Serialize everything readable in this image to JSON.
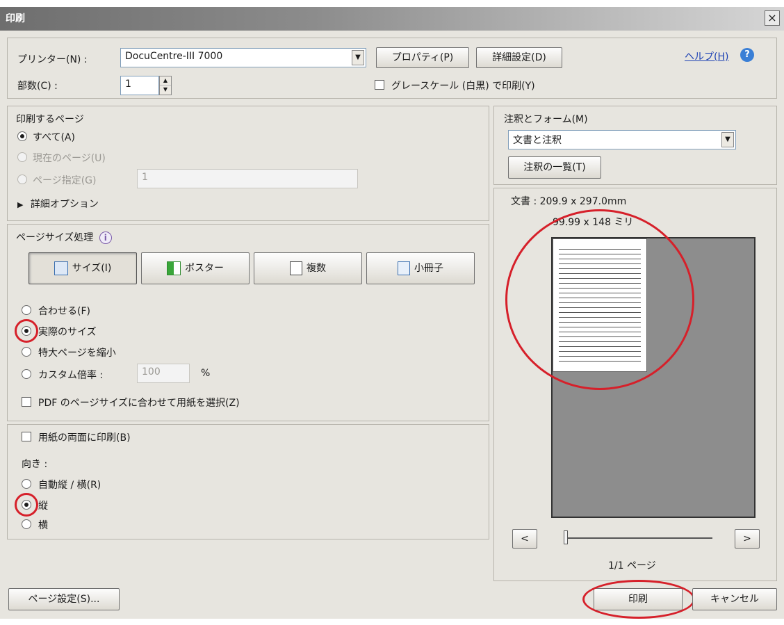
{
  "window": {
    "title": "印刷",
    "close": "×"
  },
  "printer": {
    "label": "プリンター(N) :",
    "selected": "DocuCentre-III 7000",
    "properties_button": "プロパティ(P)",
    "advanced_button": "詳細設定(D)",
    "help_link": "ヘルプ(H)",
    "copies_label": "部数(C) :",
    "copies_value": "1",
    "grayscale_label": "グレースケール (白黒) で印刷(Y)"
  },
  "pages": {
    "heading": "印刷するページ",
    "all": "すべて(A)",
    "current": "現在のページ(U)",
    "range": "ページ指定(G)",
    "range_value": "1",
    "more_options": "詳細オプション"
  },
  "page_size": {
    "heading": "ページサイズ処理",
    "tabs": [
      "サイズ(I)",
      "ポスター",
      "複数",
      "小冊子"
    ],
    "options": [
      "合わせる(F)",
      "実際のサイズ",
      "特大ページを縮小",
      "カスタム倍率 :"
    ],
    "custom_value": "100",
    "percent": "%",
    "choose_paper": "PDF のページサイズに合わせて用紙を選択(Z)"
  },
  "duplex": {
    "label": "用紙の両面に印刷(B)"
  },
  "orientation": {
    "heading": "向き :",
    "options": [
      "自動縦 / 横(R)",
      "縦",
      "横"
    ]
  },
  "annotations": {
    "heading": "注釈とフォーム(M)",
    "selected": "文書と注釈",
    "summary_button": "注釈の一覧(T)"
  },
  "preview": {
    "doc_size": "文書 : 209.9 x 297.0mm",
    "paper_size": "99.99 x 148 ミリ",
    "prev": "<",
    "next": ">",
    "page_indicator": "1/1 ページ"
  },
  "footer": {
    "page_setup": "ページ設定(S)...",
    "print": "印刷",
    "cancel": "キャンセル"
  },
  "colors": {
    "highlight_ring": "#d6202a",
    "dialog_bg": "#e7e5df",
    "link": "#1a3fb3"
  }
}
